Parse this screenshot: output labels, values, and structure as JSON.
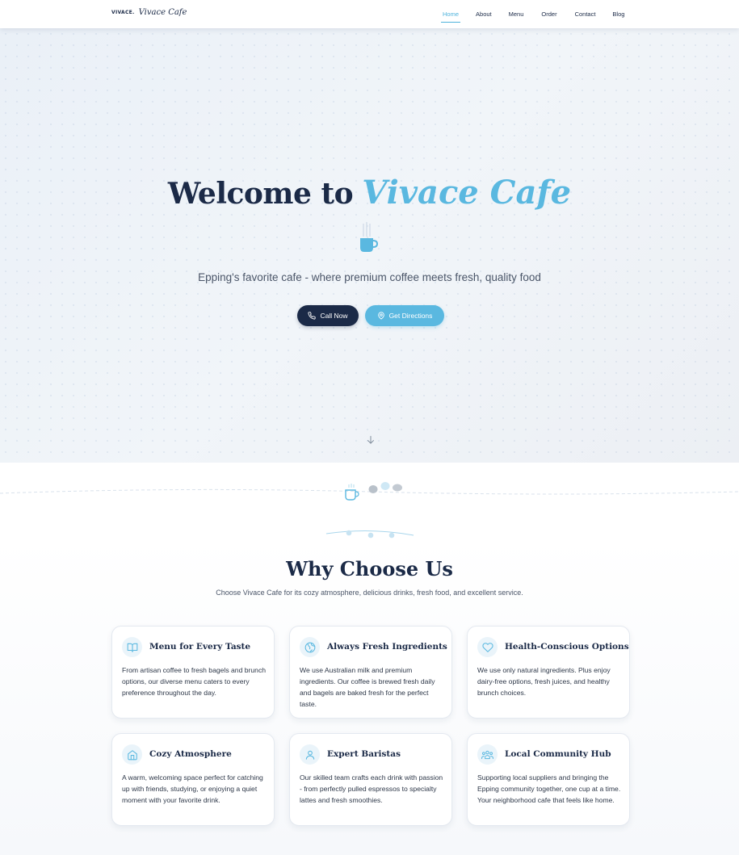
{
  "nav": {
    "logo_mark": "VIVACE.",
    "logo_script": "Vivace Cafe",
    "links": [
      "Home",
      "About",
      "Menu",
      "Order",
      "Contact",
      "Blog"
    ],
    "active": "Home"
  },
  "hero": {
    "title_a": "Welcome to",
    "title_b": "Vivace Cafe",
    "subtitle": "Epping's favorite cafe - where premium coffee meets fresh, quality food",
    "call_label": "Call Now",
    "directions_label": "Get Directions"
  },
  "why": {
    "title": "Why Choose Us",
    "subtitle": "Choose Vivace Cafe for its cozy atmosphere, delicious drinks, fresh food, and excellent service.",
    "cards": [
      {
        "icon": "book-icon",
        "title": "Menu for Every Taste",
        "desc": "From artisan coffee to fresh bagels and brunch options, our diverse menu caters to every preference throughout the day."
      },
      {
        "icon": "globe-icon",
        "title": "Always Fresh Ingredients",
        "desc": "We use Australian milk and premium ingredients. Our coffee is brewed fresh daily and bagels are baked fresh for the perfect taste."
      },
      {
        "icon": "heart-icon",
        "title": "Health-Conscious Options",
        "desc": "We use only natural ingredients. Plus enjoy dairy-free options, fresh juices, and healthy brunch choices."
      },
      {
        "icon": "home-icon",
        "title": "Cozy Atmosphere",
        "desc": "A warm, welcoming space perfect for catching up with friends, studying, or enjoying a quiet moment with your favorite drink."
      },
      {
        "icon": "user-icon",
        "title": "Expert Baristas",
        "desc": "Our skilled team crafts each drink with passion - from perfectly pulled espressos to specialty lattes and fresh smoothies."
      },
      {
        "icon": "people-icon",
        "title": "Local Community Hub",
        "desc": "Supporting local suppliers and bringing the Epping community together, one cup at a time. Your neighborhood cafe that feels like home."
      }
    ]
  },
  "colors": {
    "navy": "#1b2a47",
    "accent": "#5ab8e0",
    "accent_soft": "#eaf4fa"
  }
}
